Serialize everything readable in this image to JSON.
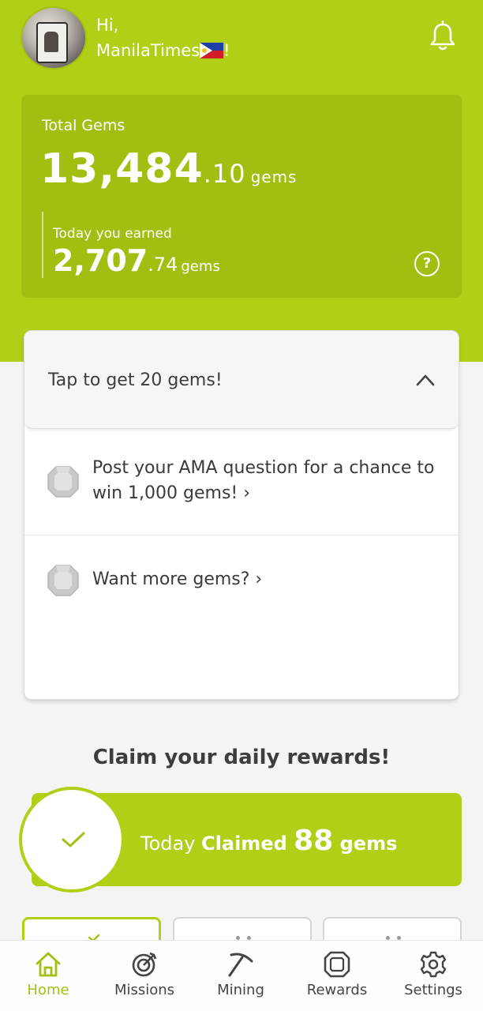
{
  "header": {
    "greeting": "Hi,",
    "username": "ManilaTimes",
    "exclamation": "!",
    "avatar_icon": "avatar-image",
    "notification_icon": "bell-icon"
  },
  "gems": {
    "total_label": "Total Gems",
    "total_int": "13,484",
    "total_dec": ".10",
    "unit": "gems",
    "today_label": "Today you earned",
    "today_int": "2,707",
    "today_dec": ".74",
    "help_symbol": "?"
  },
  "tap_section": {
    "title": "Tap to get 20 gems!",
    "items": [
      {
        "text": "Post your AMA question for a chance to win 1,000 gems! ›",
        "icon": "gem-icon"
      },
      {
        "text": "Want more gems? ›",
        "icon": "gem-icon"
      }
    ]
  },
  "daily": {
    "title": "Claim your daily rewards!",
    "prefix": "Today ",
    "claimed_word": "Claimed ",
    "amount": "88",
    "unit": " gems"
  },
  "nav": {
    "items": [
      {
        "label": "Home",
        "icon": "home-icon",
        "active": true
      },
      {
        "label": "Missions",
        "icon": "target-icon",
        "active": false
      },
      {
        "label": "Mining",
        "icon": "pickaxe-icon",
        "active": false
      },
      {
        "label": "Rewards",
        "icon": "gem-outline-icon",
        "active": false
      },
      {
        "label": "Settings",
        "icon": "gear-icon",
        "active": false
      }
    ]
  },
  "colors": {
    "brand": "#b0cf16",
    "card": "#a1bf11",
    "text_dark": "#3d3d3d"
  }
}
